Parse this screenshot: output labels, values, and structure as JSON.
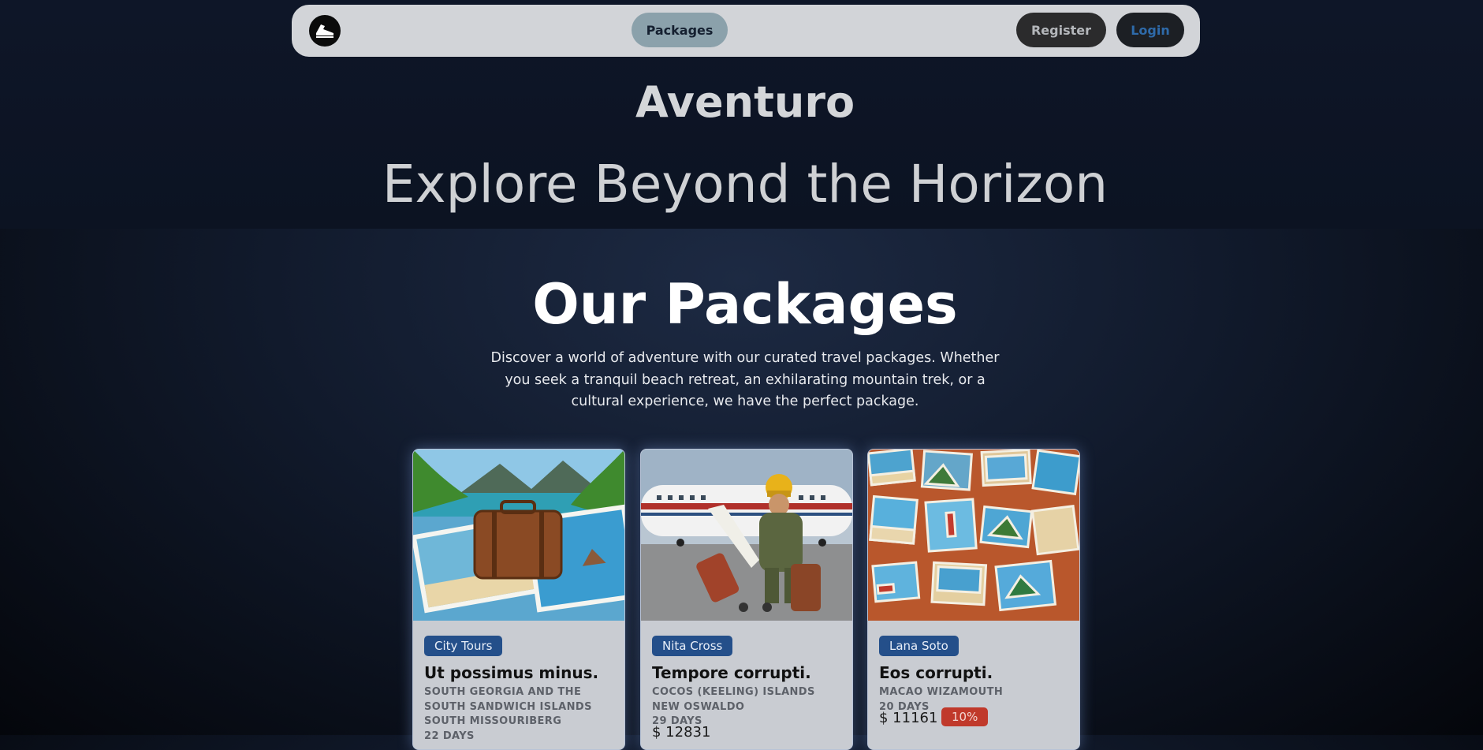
{
  "nav": {
    "logo_icon": "running-shoe-icon",
    "packages_label": "Packages",
    "register_label": "Register",
    "login_label": "Login"
  },
  "hero": {
    "brand": "Aventuro",
    "tagline": "Explore Beyond the Horizon"
  },
  "packages": {
    "title": "Our Packages",
    "description": "Discover a world of adventure with our curated travel packages. Whether you seek a tranquil beach retreat, an exhilarating mountain trek, or a cultural experience, we have the perfect package.",
    "cards": [
      {
        "image": "beach-suitcase-collage",
        "tag": "City Tours",
        "title": "Ut possimus minus.",
        "country": "South Georgia and the South Sandwich Islands",
        "city": "South Missouriberg",
        "duration": "22 days",
        "price": ""
      },
      {
        "image": "traveler-airplane-tarmac",
        "tag": "Nita Cross",
        "title": "Tempore corrupti.",
        "country": "Cocos (Keeling) Islands",
        "city": "New Oswaldo",
        "duration": "29 days",
        "price": "$ 12831"
      },
      {
        "image": "postcards-board",
        "tag": "Lana Soto",
        "title": "Eos corrupti.",
        "country": "Macao",
        "city": "Wizamouth",
        "duration": "20 days",
        "price": "$ 11161",
        "discount": "10%"
      }
    ]
  },
  "colors": {
    "navbar_bg": "#d2d4d8",
    "active_pill": "#8ba1ab",
    "tag_chip": "#244f8a",
    "discount_badge": "#c0392b",
    "login_text": "#2e6aa9"
  }
}
